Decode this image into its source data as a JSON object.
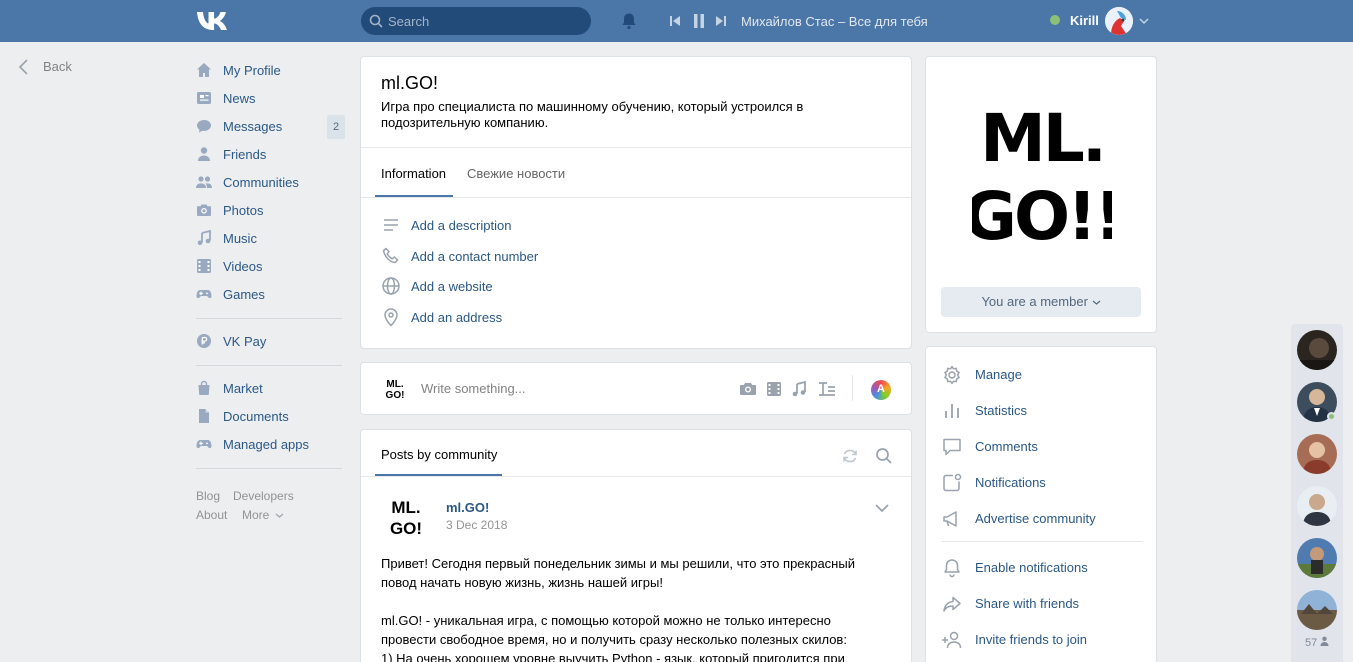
{
  "header": {
    "search_placeholder": "Search",
    "now_playing": "Михайлов Стас – Все для тебя",
    "user_name": "Kirill",
    "brand_color": "#4a76a8"
  },
  "back_label": "Back",
  "nav": {
    "items": [
      {
        "label": "My Profile",
        "icon": "home-icon"
      },
      {
        "label": "News",
        "icon": "newspaper-icon"
      },
      {
        "label": "Messages",
        "icon": "chat-bubble-icon",
        "badge": "2"
      },
      {
        "label": "Friends",
        "icon": "person-icon"
      },
      {
        "label": "Communities",
        "icon": "group-icon"
      },
      {
        "label": "Photos",
        "icon": "camera-icon"
      },
      {
        "label": "Music",
        "icon": "music-note-icon"
      },
      {
        "label": "Videos",
        "icon": "film-icon"
      },
      {
        "label": "Games",
        "icon": "gamepad-icon"
      },
      {
        "label": "VK Pay",
        "icon": "ruble-coin-icon"
      },
      {
        "label": "Market",
        "icon": "shopping-bag-icon"
      },
      {
        "label": "Documents",
        "icon": "document-icon"
      },
      {
        "label": "Managed apps",
        "icon": "gamepad-icon"
      }
    ],
    "footer": {
      "blog": "Blog",
      "developers": "Developers",
      "about": "About",
      "more": "More"
    }
  },
  "group": {
    "name": "ml.GO!",
    "status": "Игра про специалиста по машинному обучению, который устроился в подозрительную компанию.",
    "tabs": [
      "Information",
      "Свежие новости"
    ],
    "info_links": [
      {
        "label": "Add a description",
        "icon": "text-lines-icon"
      },
      {
        "label": "Add a contact number",
        "icon": "phone-icon"
      },
      {
        "label": "Add a website",
        "icon": "globe-icon"
      },
      {
        "label": "Add an address",
        "icon": "location-pin-icon"
      }
    ],
    "logo_text": "ML. GO!!"
  },
  "composer": {
    "placeholder": "Write something...",
    "color_label": "A"
  },
  "posts": {
    "tab": "Posts by community",
    "post": {
      "author": "ml.GO!",
      "date": "3 Dec 2018",
      "paragraphs": [
        "Привет! Сегодня первый понедельник зимы и мы решили, что это прекрасный повод начать новую жизнь, жизнь нашей игры!",
        "ml.GO! - уникальная игра, с помощью которой можно не только интересно провести свободное время, но и получить сразу несколько полезных скилов:\n1) На очень хорошем уровне выучить Python - язык, который пригодится при"
      ]
    }
  },
  "member_button": "You are a member",
  "manage_menu": {
    "group1": [
      {
        "label": "Manage",
        "icon": "gear-icon"
      },
      {
        "label": "Statistics",
        "icon": "bar-chart-icon"
      },
      {
        "label": "Comments",
        "icon": "comment-icon"
      },
      {
        "label": "Notifications",
        "icon": "notification-badge-icon"
      },
      {
        "label": "Advertise community",
        "icon": "megaphone-icon"
      }
    ],
    "group2": [
      {
        "label": "Enable notifications",
        "icon": "bell-icon"
      },
      {
        "label": "Share with friends",
        "icon": "share-arrow-icon"
      },
      {
        "label": "Invite friends to join",
        "icon": "add-person-icon"
      }
    ]
  },
  "friends_online_count": "57"
}
